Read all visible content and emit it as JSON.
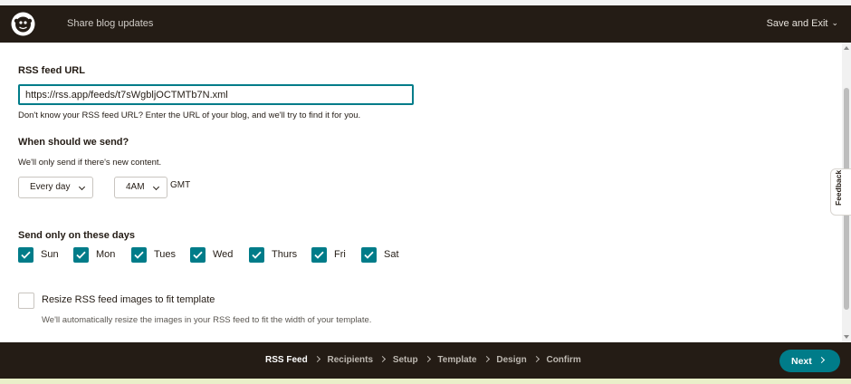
{
  "header": {
    "title": "Share blog updates",
    "save_exit_label": "Save and Exit"
  },
  "rss": {
    "label": "RSS feed URL",
    "value": "https://rss.app/feeds/t7sWgbljOCTMTb7N.xml",
    "help": "Don't know your RSS feed URL? Enter the URL of your blog, and we'll try to find it for you."
  },
  "schedule": {
    "label": "When should we send?",
    "help": "We'll only send if there's new content.",
    "frequency": "Every day",
    "time": "4AM",
    "timezone": "GMT"
  },
  "days": {
    "label": "Send only on these days",
    "items": [
      {
        "label": "Sun",
        "checked": true
      },
      {
        "label": "Mon",
        "checked": true
      },
      {
        "label": "Tues",
        "checked": true
      },
      {
        "label": "Wed",
        "checked": true
      },
      {
        "label": "Thurs",
        "checked": true
      },
      {
        "label": "Fri",
        "checked": true
      },
      {
        "label": "Sat",
        "checked": true
      }
    ]
  },
  "resize": {
    "label": "Resize RSS feed images to fit template",
    "help": "We'll automatically resize the images in your RSS feed to fit the width of your template.",
    "checked": false
  },
  "feedback": {
    "label": "Feedback"
  },
  "footer": {
    "steps": [
      "RSS Feed",
      "Recipients",
      "Setup",
      "Template",
      "Design",
      "Confirm"
    ],
    "active_step": "RSS Feed",
    "next_label": "Next"
  },
  "colors": {
    "brand_dark": "#241c15",
    "accent": "#007c89"
  },
  "icons": {
    "logo": "mailchimp-freddie-icon",
    "check": "check-icon",
    "chevron": "chevron-down-icon"
  }
}
